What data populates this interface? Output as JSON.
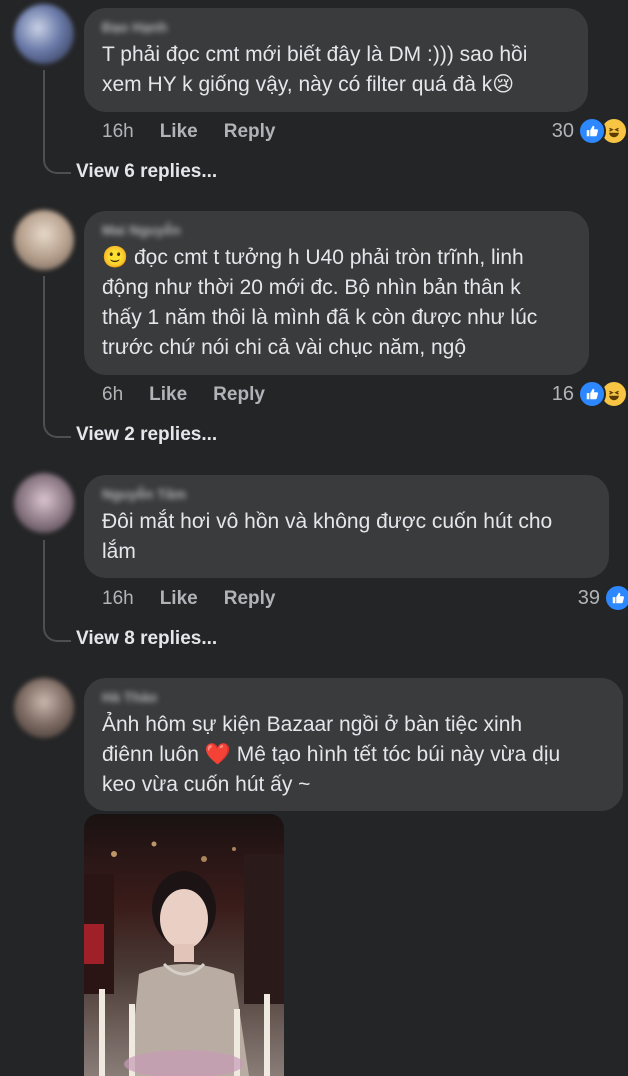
{
  "comments": [
    {
      "author": "Đạo Hạnh",
      "text": "T phải đọc cmt mới biết đây là DM :))) sao hồi\nxem HY k giống vậy, này có filter quá đà k",
      "trailing_emoji": "😢",
      "time": "16h",
      "like_label": "Like",
      "reply_label": "Reply",
      "reaction_count": "30",
      "view_replies": "View 6 replies..."
    },
    {
      "author": "Mai Nguyễn",
      "leading_emoji": "🙂",
      "text": "đọc cmt t tưởng h U40 phải tròn trĩnh, linh\nđộng như thời 20 mới đc. Bộ nhìn bản thân k\nthấy 1 năm thôi là mình đã k còn được như lúc\ntrước chứ nói chi cả vài chục năm, ngộ",
      "time": "6h",
      "like_label": "Like",
      "reply_label": "Reply",
      "reaction_count": "16",
      "view_replies": "View 2 replies..."
    },
    {
      "author": "Nguyễn Tâm",
      "text": "Đôi mắt hơi vô hồn và không được cuốn hút cho\nlắm",
      "time": "16h",
      "like_label": "Like",
      "reply_label": "Reply",
      "reaction_count": "39",
      "view_replies": "View 8 replies..."
    },
    {
      "author": "Hà Thảo",
      "text_line1": "Ảnh hôm sự kiện Bazaar ngồi ở bàn tiệc xinh",
      "text_line2_a": "điênn luôn",
      "heart": "❤️",
      "text_line2_b": "Mê tạo hình tết tóc búi này vừa dịu",
      "text_line3": "keo vừa cuốn hút ấy ~"
    }
  ],
  "colors": {
    "background": "#242526",
    "bubble": "#3a3b3c",
    "like_blue": "#2d88ff",
    "haha_yellow": "#f7c443",
    "secondary_text": "#b0b3b8"
  },
  "icons": [
    "like-reaction-icon",
    "haha-reaction-icon",
    "heart-emoji",
    "avatar"
  ]
}
